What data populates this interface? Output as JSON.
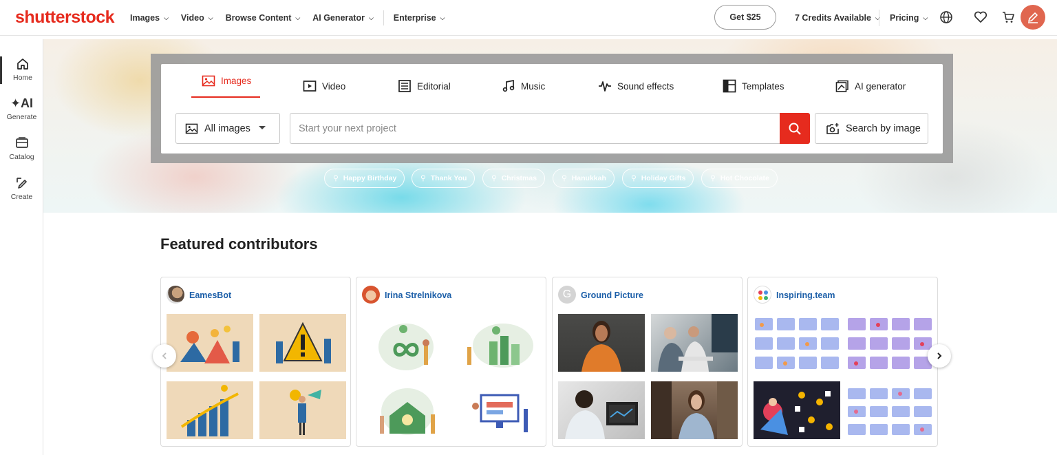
{
  "header": {
    "logo": "shutterstock",
    "nav": [
      {
        "label": "Images"
      },
      {
        "label": "Video"
      },
      {
        "label": "Browse Content"
      },
      {
        "label": "AI Generator"
      },
      {
        "label": "Enterprise"
      }
    ],
    "get_button": "Get $25",
    "credits": "7 Credits Available",
    "pricing": "Pricing"
  },
  "sidebar": {
    "items": [
      {
        "label": "Home",
        "icon": "home-icon"
      },
      {
        "label": "Generate",
        "icon": "ai-sparkle-icon"
      },
      {
        "label": "Catalog",
        "icon": "catalog-icon"
      },
      {
        "label": "Create",
        "icon": "create-icon"
      }
    ]
  },
  "search": {
    "tabs": [
      {
        "label": "Images",
        "icon": "image-icon",
        "active": true
      },
      {
        "label": "Video",
        "icon": "video-icon"
      },
      {
        "label": "Editorial",
        "icon": "editorial-icon"
      },
      {
        "label": "Music",
        "icon": "music-icon"
      },
      {
        "label": "Sound effects",
        "icon": "waveform-icon"
      },
      {
        "label": "Templates",
        "icon": "templates-icon"
      },
      {
        "label": "AI generator",
        "icon": "ai-generator-icon"
      }
    ],
    "type_select": "All images",
    "placeholder": "Start your next project",
    "search_by_image": "Search by image",
    "chips": [
      "Happy Birthday",
      "Thank You",
      "Christmas",
      "Hanukkah",
      "Holiday Gifts",
      "Hot Chocolate"
    ]
  },
  "featured": {
    "title": "Featured contributors",
    "contributors": [
      {
        "name": "EamesBot"
      },
      {
        "name": "Irina Strelnikova"
      },
      {
        "name": "Ground Picture",
        "initial": "G"
      },
      {
        "name": "Inspiring.team"
      }
    ]
  },
  "colors": {
    "brand": "#e62b1e",
    "link": "#1b5ea8"
  }
}
